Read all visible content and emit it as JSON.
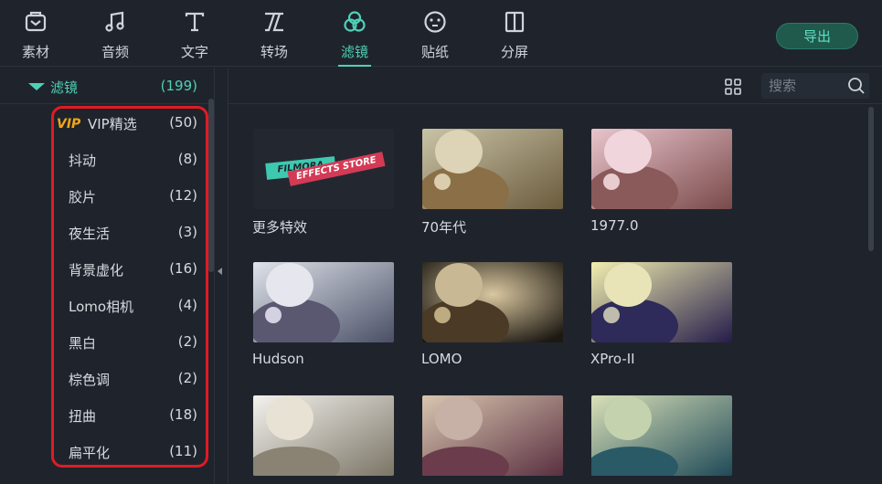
{
  "toolbar": {
    "tabs": [
      {
        "label": "素材",
        "icon": "media-folder-icon"
      },
      {
        "label": "音频",
        "icon": "music-note-icon"
      },
      {
        "label": "文字",
        "icon": "text-icon"
      },
      {
        "label": "转场",
        "icon": "transition-icon"
      },
      {
        "label": "滤镜",
        "icon": "filter-icon",
        "active": true
      },
      {
        "label": "贴纸",
        "icon": "sticker-icon"
      },
      {
        "label": "分屏",
        "icon": "split-screen-icon"
      }
    ],
    "export_label": "导出",
    "accent_color": "#4fd1b6"
  },
  "sidebar": {
    "header": {
      "name": "滤镜",
      "count": "(199)"
    },
    "categories": [
      {
        "badge": "VIP",
        "name": "VIP精选",
        "count": "(50)"
      },
      {
        "name": "抖动",
        "count": "(8)"
      },
      {
        "name": "胶片",
        "count": "(12)"
      },
      {
        "name": "夜生活",
        "count": "(3)"
      },
      {
        "name": "背景虚化",
        "count": "(16)"
      },
      {
        "name": "Lomo相机",
        "count": "(4)"
      },
      {
        "name": "黑白",
        "count": "(2)"
      },
      {
        "name": "棕色调",
        "count": "(2)"
      },
      {
        "name": "扭曲",
        "count": "(18)"
      },
      {
        "name": "扁平化",
        "count": "(11)"
      }
    ]
  },
  "main": {
    "search_placeholder": "搜索",
    "store_card": {
      "line1": "FILMORA",
      "line2": "EFFECTS STORE"
    },
    "filters": [
      {
        "label": "更多特效"
      },
      {
        "label": "70年代"
      },
      {
        "label": "1977.0"
      },
      {
        "label": "Hudson"
      },
      {
        "label": "LOMO"
      },
      {
        "label": "XPro-II"
      },
      {
        "label": ""
      },
      {
        "label": ""
      },
      {
        "label": ""
      }
    ]
  }
}
